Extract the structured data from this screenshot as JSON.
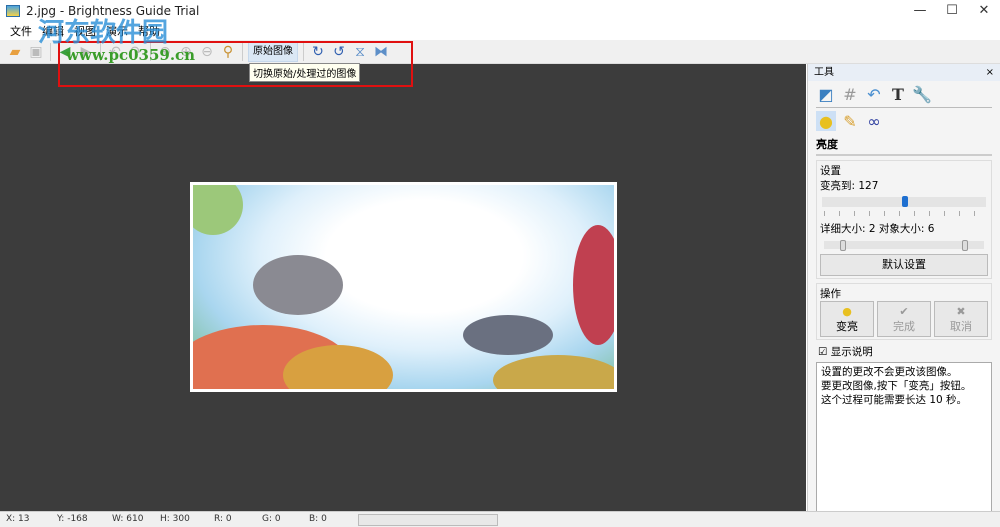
{
  "window": {
    "title": "2.jpg - Brightness Guide Trial",
    "minimize": "—",
    "maximize": "☐",
    "close": "✕"
  },
  "menu": [
    "文件",
    "编辑",
    "视图",
    "演示",
    "帮助"
  ],
  "toolbar": {
    "original_button": "原始图像",
    "tooltip": "切换原始/处理过的图像"
  },
  "watermark": {
    "site_name": "河东软件园",
    "url": "www.pc0359.cn"
  },
  "panel": {
    "title": "工具",
    "close": "×",
    "section": "亮度",
    "settings": {
      "group": "设置",
      "brighten_label": "变亮到: 127",
      "brighten_value": 127,
      "brighten_max": 255,
      "size_label": "详细大小: 2  对象大小: 6",
      "default_button": "默认设置"
    },
    "actions": {
      "group": "操作",
      "brighten": "变亮",
      "done": "完成",
      "cancel": "取消"
    },
    "show_desc": "显示说明",
    "description": [
      "设置的更改不会更改该图像。",
      "要更改图像,按下「变亮」按钮。",
      "这个过程可能需要长达 10 秒。"
    ]
  },
  "status": {
    "x": "X: 13",
    "y": "Y: -168",
    "w": "W: 610",
    "h": "H: 300",
    "r": "R: 0",
    "g": "G: 0",
    "b": "B: 0"
  }
}
